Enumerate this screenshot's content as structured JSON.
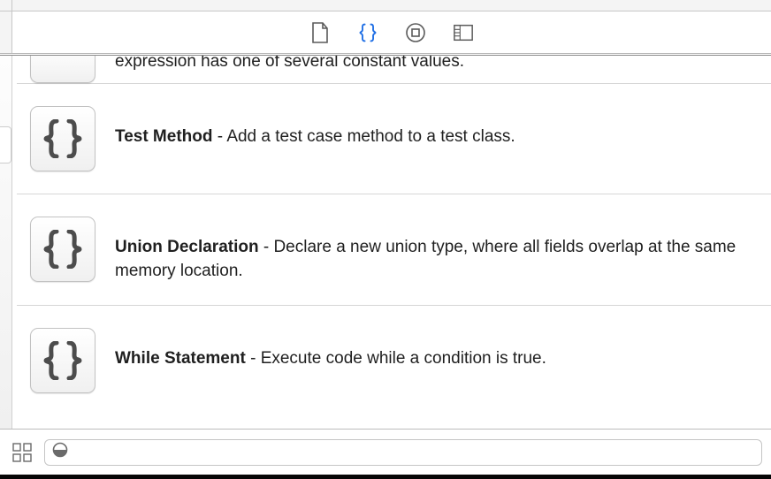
{
  "toolbar": {
    "file_icon": "file-icon",
    "braces_icon": "braces-icon",
    "object_icon": "object-icon",
    "ui_icon": "ui-icon"
  },
  "snippets": [
    {
      "title": "",
      "desc": "expression has one of several constant values.",
      "partial": true
    },
    {
      "title": "Test Method",
      "desc": " - Add a test case method to a test class.",
      "partial": false
    },
    {
      "title": "Union Declaration",
      "desc": " - Declare a new union type, where all fields overlap at the same memory location.",
      "partial": false
    },
    {
      "title": "While Statement",
      "desc": " - Execute code while a condition is true.",
      "partial": false
    }
  ],
  "search": {
    "placeholder": ""
  }
}
